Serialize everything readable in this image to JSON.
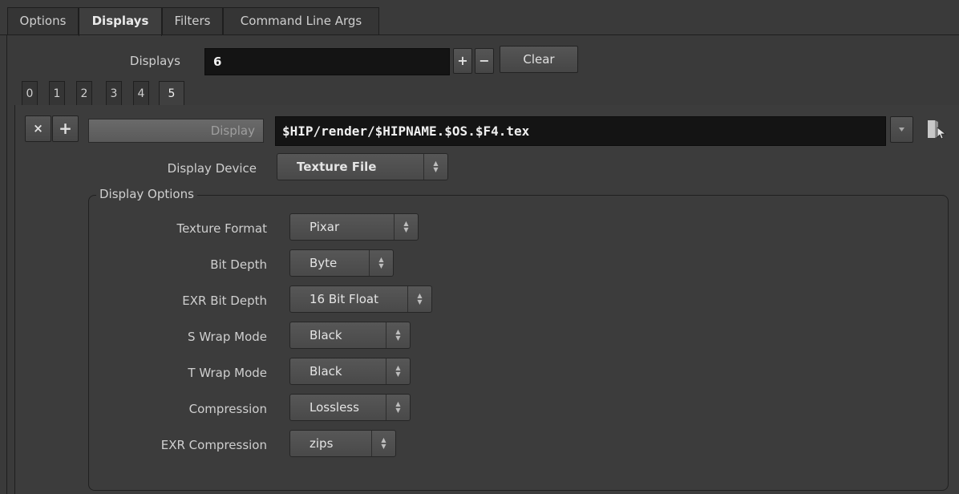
{
  "top_tabs": [
    {
      "label": "Options",
      "active": false
    },
    {
      "label": "Displays",
      "active": true
    },
    {
      "label": "Filters",
      "active": false
    },
    {
      "label": "Command Line Args",
      "active": false
    }
  ],
  "displays": {
    "label": "Displays",
    "value": "6",
    "plus": "+",
    "minus": "−",
    "clear": "Clear"
  },
  "display_tabs": [
    "0",
    "1",
    "2",
    "3",
    "4",
    "5"
  ],
  "active_display_tab": "5",
  "display": {
    "remove": "×",
    "add": "+",
    "label": "Display",
    "path": "$HIP/render/$HIPNAME.$OS.$F4.tex",
    "dropdown_icon": "triangle-down-icon",
    "browse_icon": "file-browse-icon"
  },
  "display_device": {
    "label": "Display Device",
    "value": "Texture File"
  },
  "display_options": {
    "title": "Display Options",
    "rows": [
      {
        "label": "Texture Format",
        "value": "Pixar"
      },
      {
        "label": "Bit Depth",
        "value": "Byte"
      },
      {
        "label": "EXR Bit Depth",
        "value": "16 Bit Float"
      },
      {
        "label": "S Wrap Mode",
        "value": "Black"
      },
      {
        "label": "T Wrap Mode",
        "value": "Black"
      },
      {
        "label": "Compression",
        "value": "Lossless"
      },
      {
        "label": "EXR Compression",
        "value": "zips"
      }
    ]
  },
  "colors": {
    "background": "#3a3a3a",
    "field": "#141414",
    "button": "#505050"
  }
}
